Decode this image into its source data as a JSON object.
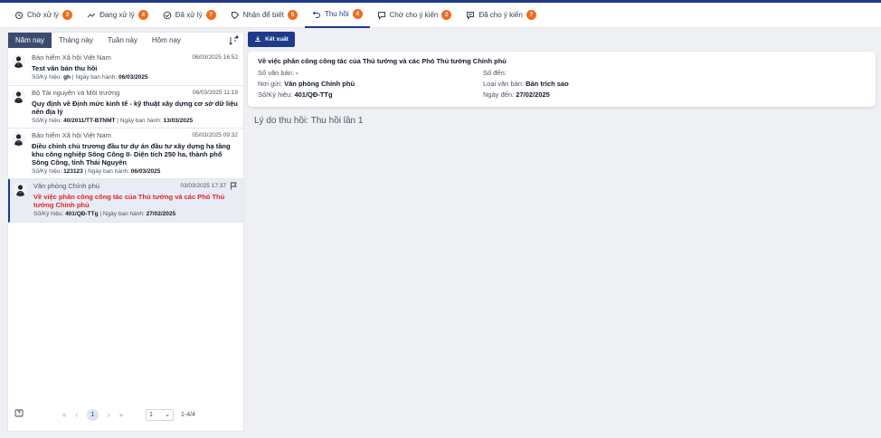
{
  "tabs": [
    {
      "label": "Chờ xử lý",
      "badge": "2",
      "icon": "pending-icon"
    },
    {
      "label": "Đang xử lý",
      "badge": "4",
      "icon": "trend-icon"
    },
    {
      "label": "Đã xử lý",
      "badge": "7",
      "icon": "check-circle-icon"
    },
    {
      "label": "Nhận để biết",
      "badge": "5",
      "icon": "tag-icon"
    },
    {
      "label": "Thu hồi",
      "badge": "4",
      "icon": "undo-icon"
    },
    {
      "label": "Chờ cho ý kiến",
      "badge": "2",
      "icon": "comment-icon"
    },
    {
      "label": "Đã cho ý kiến",
      "badge": "7",
      "icon": "comment-lines-icon"
    }
  ],
  "active_tab": 4,
  "filters": [
    "Năm nay",
    "Tháng này",
    "Tuần này",
    "Hôm nay"
  ],
  "active_filter": 0,
  "list": [
    {
      "sender": "Bảo hiểm Xã hội Việt Nam",
      "time": "06/03/2025 16:52",
      "title": "Test văn bản thu hồi",
      "code_label": "Số/Ký hiệu:",
      "code": "gh",
      "date_label": "Ngày ban hành:",
      "date": "06/03/2025"
    },
    {
      "sender": "Bộ Tài nguyên và Môi trường",
      "time": "06/03/2025 11:19",
      "title": "Quy định về Định mức kinh tế - kỹ thuật xây dựng cơ sở dữ liệu nền địa lý",
      "code_label": "Số/Ký hiệu:",
      "code": "40/2011/TT-BTNMT",
      "date_label": "Ngày ban hành:",
      "date": "13/03/2025"
    },
    {
      "sender": "Bảo hiểm Xã hội Việt Nam",
      "time": "05/03/2025 09:32",
      "title": "Điều chỉnh chủ trương đầu tư dự án đầu tư xây dựng hạ tầng khu công nghiệp Sông Công II- Diện tích 250 ha, thành phố Sông Công, tỉnh Thái Nguyên",
      "code_label": "Số/Ký hiệu:",
      "code": "123123",
      "date_label": "Ngày ban hành:",
      "date": "06/03/2025"
    },
    {
      "sender": "Văn phòng Chính phủ",
      "time": "03/03/2025 17:37",
      "title": "Về việc phân công công tác của Thủ tướng và các Phó Thủ tướng Chính phủ",
      "code_label": "Số/Ký hiệu:",
      "code": "401/QĐ-TTg",
      "date_label": "Ngày ban hành:",
      "date": "27/02/2025"
    }
  ],
  "pagination": {
    "first": "«",
    "prev": "‹",
    "current": "1",
    "next": "›",
    "last": "»",
    "page_select": "1",
    "range": "1-4/4"
  },
  "export_label": "Kết xuất",
  "detail": {
    "title": "Về việc phân công công tác của Thủ tướng và các Phó Thủ tướng Chính phủ",
    "so_van_ban_label": "Số văn bản:",
    "so_van_ban": "-",
    "so_den_label": "Số đến:",
    "so_den": "",
    "noi_gui_label": "Nơi gửi:",
    "noi_gui": "Văn phòng Chính phủ",
    "loai_label": "Loại văn bản:",
    "loai": "Bản trích sao",
    "ky_hieu_label": "Số/Ký hiệu:",
    "ky_hieu": "401/QĐ-TTg",
    "ngay_den_label": "Ngày đến:",
    "ngay_den": "27/02/2025"
  },
  "reason": "Lý do thu hồi: Thu hồi lần 1",
  "colors": {
    "primary": "#1e3a8a",
    "badge": "#f26b1d",
    "selected_title": "#dc2626"
  }
}
